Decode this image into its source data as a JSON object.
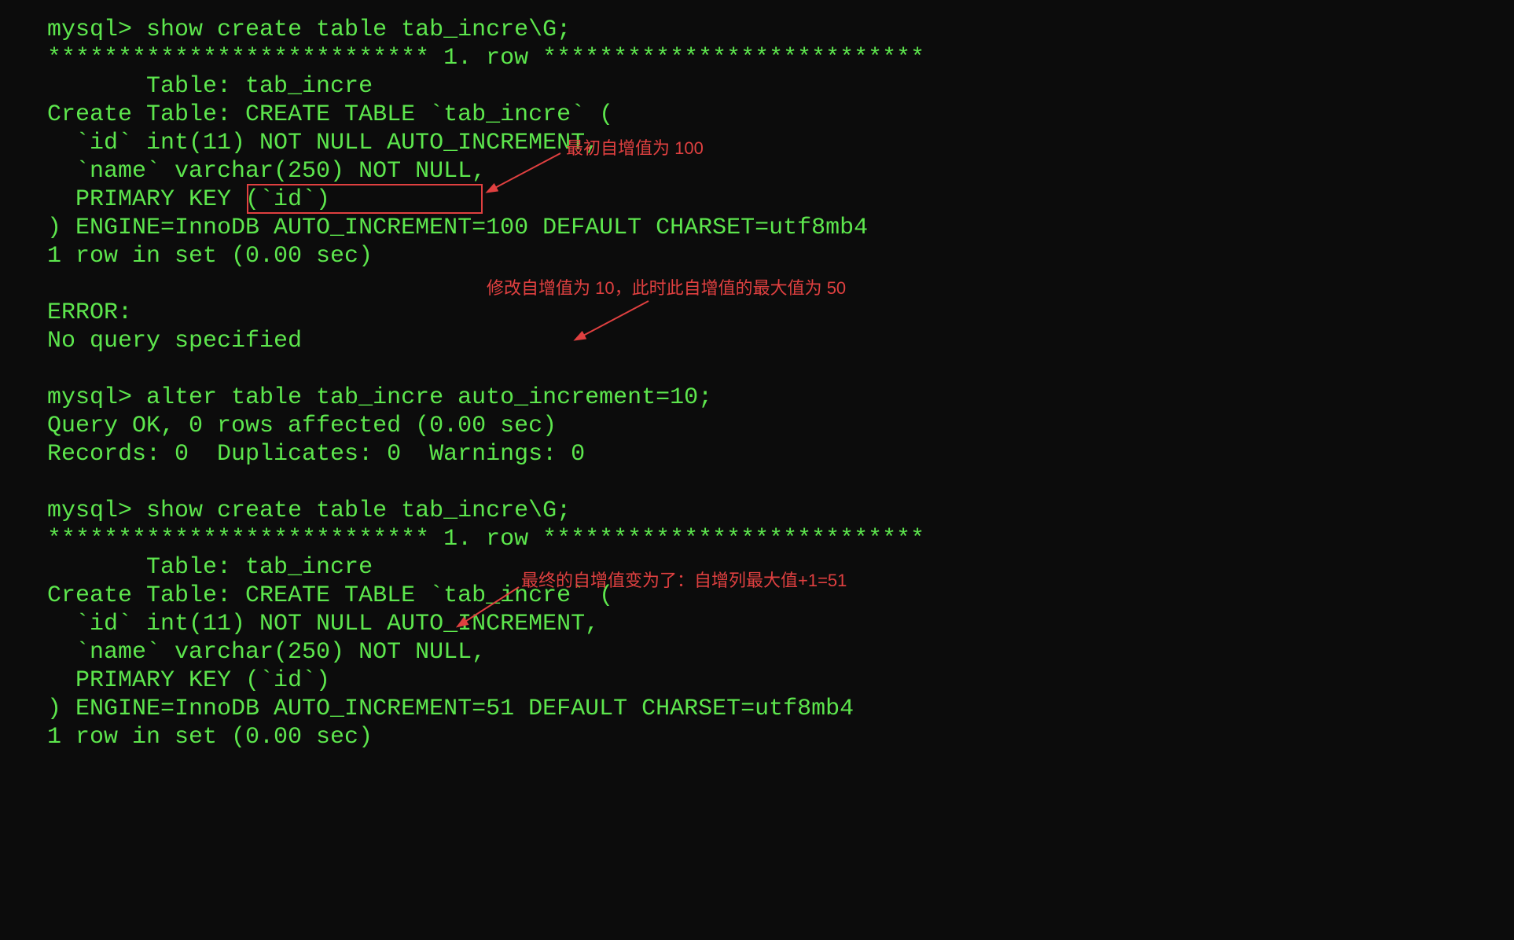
{
  "terminal": {
    "lines": [
      "mysql> show create table tab_incre\\G;",
      "*************************** 1. row ***************************",
      "       Table: tab_incre",
      "Create Table: CREATE TABLE `tab_incre` (",
      "  `id` int(11) NOT NULL AUTO_INCREMENT,",
      "  `name` varchar(250) NOT NULL,",
      "  PRIMARY KEY (`id`)",
      ") ENGINE=InnoDB AUTO_INCREMENT=100 DEFAULT CHARSET=utf8mb4",
      "1 row in set (0.00 sec)",
      "",
      "ERROR:",
      "No query specified",
      "",
      "mysql> alter table tab_incre auto_increment=10;",
      "Query OK, 0 rows affected (0.00 sec)",
      "Records: 0  Duplicates: 0  Warnings: 0",
      "",
      "mysql> show create table tab_incre\\G;",
      "*************************** 1. row ***************************",
      "       Table: tab_incre",
      "Create Table: CREATE TABLE `tab_incre` (",
      "  `id` int(11) NOT NULL AUTO_INCREMENT,",
      "  `name` varchar(250) NOT NULL,",
      "  PRIMARY KEY (`id`)",
      ") ENGINE=InnoDB AUTO_INCREMENT=51 DEFAULT CHARSET=utf8mb4",
      "1 row in set (0.00 sec)"
    ]
  },
  "annotations": {
    "note1": "最初自增值为 100",
    "note2": "修改自增值为 10，此时此自增值的最大值为 50",
    "note3": "最终的自增值变为了：自增列最大值+1=51"
  }
}
